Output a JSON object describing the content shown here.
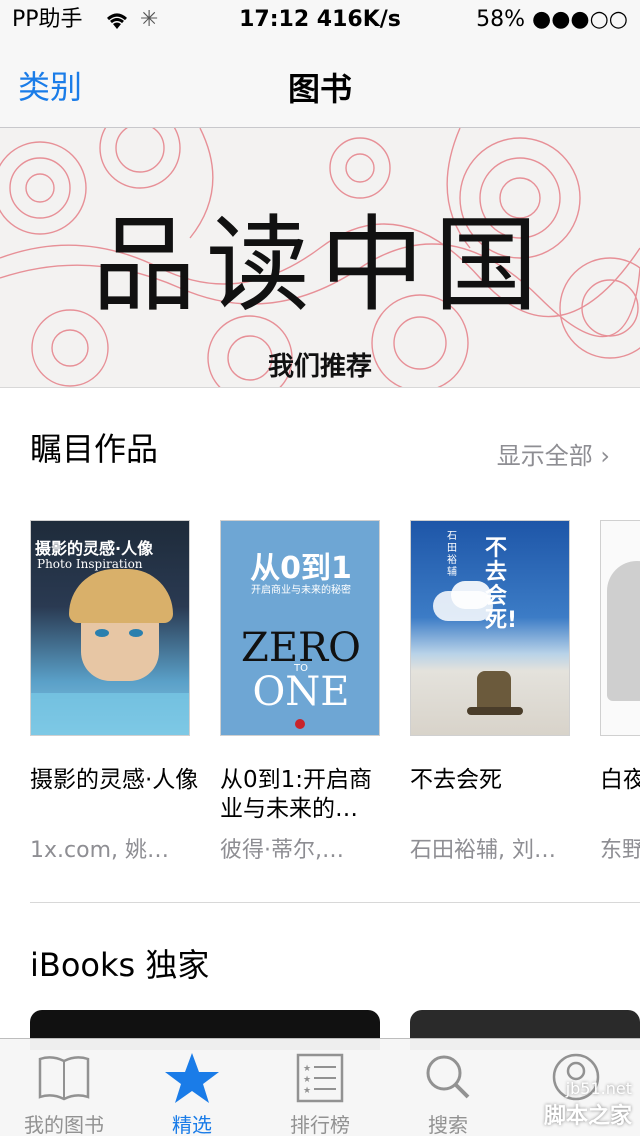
{
  "status_bar": {
    "carrier": "PP助手",
    "time": "17:12",
    "speed": "416K/s",
    "battery": "58%"
  },
  "nav": {
    "back_label": "类别",
    "title": "图书"
  },
  "banner": {
    "headline": "品读中国",
    "subtitle": "我们推荐"
  },
  "section_featured": {
    "title": "瞩目作品",
    "see_all": "显示全部"
  },
  "books": [
    {
      "title": "摄影的灵感·人像",
      "author": "1x.com, 姚…",
      "cover_text": {
        "title": "摄影的灵感·人像",
        "subtitle": "Photo Inspiration"
      }
    },
    {
      "title": "从0到1:开启商业与未来的…",
      "author": "彼得·蒂尔,…",
      "cover_text": {
        "title": "从0到1",
        "subtitle": "开启商业与未来的秘密",
        "en_1": "ZERO",
        "en_to": "TO",
        "en_2": "ONE"
      }
    },
    {
      "title": "不去会死",
      "author": "石田裕辅, 刘…",
      "cover_text": {
        "title": "不去会死!",
        "author": "石田裕辅"
      }
    },
    {
      "title": "白夜",
      "author": "东野"
    }
  ],
  "section_exclusive": {
    "title": "iBooks 独家"
  },
  "tabs": [
    {
      "label": "我的图书",
      "icon": "book-icon"
    },
    {
      "label": "精选",
      "icon": "star-icon",
      "active": true
    },
    {
      "label": "排行榜",
      "icon": "list-icon"
    },
    {
      "label": "搜索",
      "icon": "search-icon"
    },
    {
      "label": "",
      "icon": "purchased-icon"
    }
  ],
  "watermark": {
    "site": "jb51.net",
    "name": "脚本之家"
  },
  "colors": {
    "accent": "#1a7ce8",
    "secondary_text": "#8e8e93"
  }
}
